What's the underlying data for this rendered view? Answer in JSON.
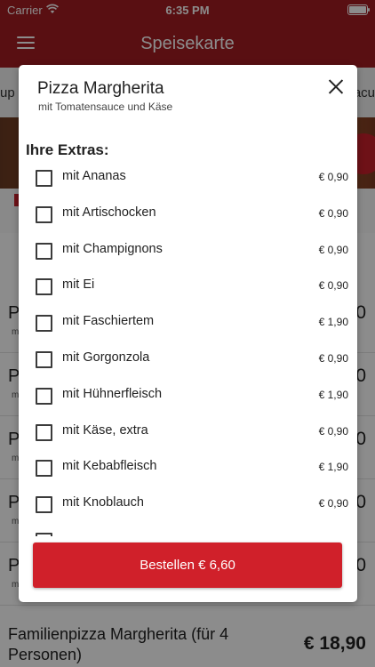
{
  "status": {
    "carrier": "Carrier",
    "time": "6:35 PM"
  },
  "nav": {
    "title": "Speisekarte"
  },
  "tabs": {
    "left": "up",
    "right": "acu"
  },
  "colors": {
    "brand": "#a31d22",
    "button": "#d0202a"
  },
  "background_rows": [
    {
      "label": "P",
      "sub": "m",
      "price": "0"
    },
    {
      "label": "P",
      "sub": "m",
      "price": "0"
    },
    {
      "label": "P",
      "sub": "m",
      "price": "0"
    },
    {
      "label": "P",
      "sub": "m",
      "price": "0"
    },
    {
      "label": "P",
      "sub": "m",
      "price": "0"
    }
  ],
  "bottom_item": {
    "name": "Familienpizza Margherita (für 4 Personen)",
    "price": "€ 18,90"
  },
  "modal": {
    "title": "Pizza Margherita",
    "subtitle": "mit Tomatensauce und Käse",
    "extras_heading": "Ihre Extras:",
    "extras": [
      {
        "label": "mit Ananas",
        "price": "€ 0,90"
      },
      {
        "label": "mit Artischocken",
        "price": "€ 0,90"
      },
      {
        "label": "mit Champignons",
        "price": "€ 0,90"
      },
      {
        "label": "mit Ei",
        "price": "€ 0,90"
      },
      {
        "label": "mit Faschiertem",
        "price": "€ 1,90"
      },
      {
        "label": "mit Gorgonzola",
        "price": "€ 0,90"
      },
      {
        "label": "mit Hühnerfleisch",
        "price": "€ 1,90"
      },
      {
        "label": "mit Käse, extra",
        "price": "€ 0,90"
      },
      {
        "label": "mit Kebabfleisch",
        "price": "€ 1,90"
      },
      {
        "label": "mit Knoblauch",
        "price": "€ 0,90"
      }
    ],
    "order_button": "Bestellen € 6,60"
  }
}
